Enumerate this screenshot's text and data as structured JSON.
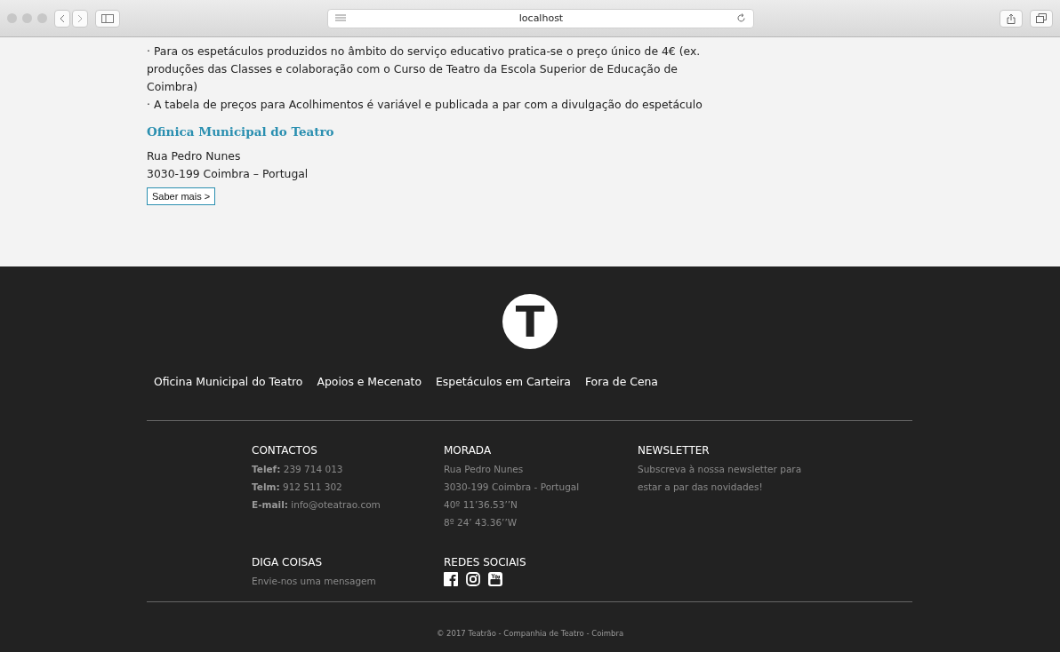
{
  "browser": {
    "address": "localhost"
  },
  "content": {
    "paragraphs": [
      "· Para os espetáculos produzidos no âmbito do serviço educativo pratica-se o preço único de 4€ (ex. produções das Classes e colaboração com o Curso de Teatro da Escola Superior de Educação de Coimbra)",
      "· A tabela de preços para Acolhimentos é variável e publicada a par com a divulgação do espetáculo"
    ],
    "heading": "Ofinica Municipal do Teatro",
    "address_lines": [
      "Rua Pedro Nunes",
      "3030-199 Coimbra – Portugal"
    ],
    "button": "Saber mais >"
  },
  "footer": {
    "logo": "T",
    "nav": [
      "Oficina Municipal do Teatro",
      "Apoios e Mecenato",
      "Espetáculos em Carteira",
      "Fora de Cena"
    ],
    "sections": [
      {
        "title": "CONTACTOS",
        "kind": "lines",
        "lines": [
          "**Telef:** 239 714 013",
          "**Telm:** 912 511 302",
          "**E-mail:** info@oteatrao.com"
        ]
      },
      {
        "title": "MORADA",
        "kind": "lines",
        "lines": [
          "Rua Pedro Nunes",
          "3030-199 Coimbra - Portugal",
          "40º 11’36.53’’N",
          "8º 24’ 43.36’’W"
        ]
      },
      {
        "title": "NEWSLETTER",
        "kind": "lines",
        "lines": [
          "Subscreva à nossa newsletter para estar a par das novidades!"
        ]
      },
      {
        "title": "DIGA COISAS",
        "kind": "lines",
        "lines": [
          "Envie-nos uma mensagem"
        ]
      },
      {
        "title": "REDES SOCIAIS",
        "kind": "social"
      }
    ],
    "copyright": "© 2017 Teatrão - Companhia de Teatro - Coimbra"
  }
}
